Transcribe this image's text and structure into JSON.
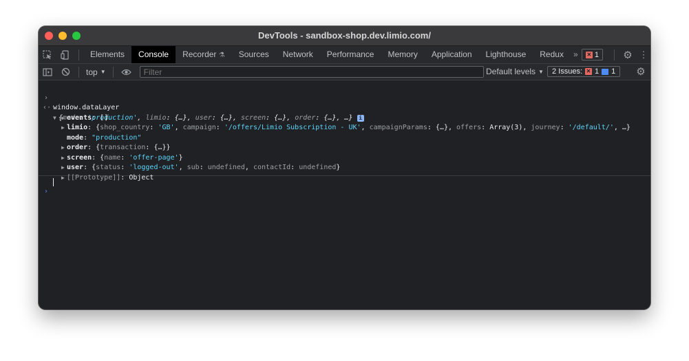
{
  "window": {
    "title": "DevTools - sandbox-shop.dev.limio.com/"
  },
  "tabs": [
    "Elements",
    "Console",
    "Recorder",
    "Sources",
    "Network",
    "Performance",
    "Memory",
    "Application",
    "Lighthouse",
    "Redux"
  ],
  "tab_overflow": "»",
  "error_badge": {
    "count": "1"
  },
  "toolbar": {
    "context": "top",
    "filter_placeholder": "Filter",
    "levels": "Default levels",
    "issues_label": "2 Issues:",
    "issues_errors": "1",
    "issues_info": "1"
  },
  "console": {
    "input_expr": "window.dataLayer",
    "summary": {
      "open": "{",
      "k1": "mode",
      "v1": "'production'",
      "k2": "limio",
      "v2": "{…}",
      "k3": "user",
      "v3": "{…}",
      "k4": "screen",
      "v4": "{…}",
      "k5": "order",
      "v5": "{…}",
      "tail": ", …}"
    },
    "events": {
      "key": "events",
      "value": "[]"
    },
    "limio": {
      "key": "limio",
      "k1": "shop_country",
      "v1": "'GB'",
      "k2": "campaign",
      "v2": "'/offers/Limio Subscription - UK'",
      "k3": "campaignParams",
      "v3": "{…}",
      "k4": "offers",
      "v4": "Array(3)",
      "k5": "journey",
      "v5": "'/default/'",
      "tail": ", …}"
    },
    "mode": {
      "key": "mode",
      "value": "\"production\""
    },
    "order": {
      "key": "order",
      "k1": "transaction",
      "v1": "{…}"
    },
    "screen": {
      "key": "screen",
      "k1": "name",
      "v1": "'offer-page'"
    },
    "user": {
      "key": "user",
      "k1": "status",
      "v1": "'logged-out'",
      "k2": "sub",
      "v2": "undefined",
      "k3": "contactId",
      "v3": "undefined"
    },
    "prototype": {
      "key": "[[Prototype]]",
      "value": "Object"
    }
  },
  "colors": {
    "string": "#5cd5fb",
    "error": "#e46962",
    "info": "#4d8bf5",
    "background": "#202124"
  }
}
